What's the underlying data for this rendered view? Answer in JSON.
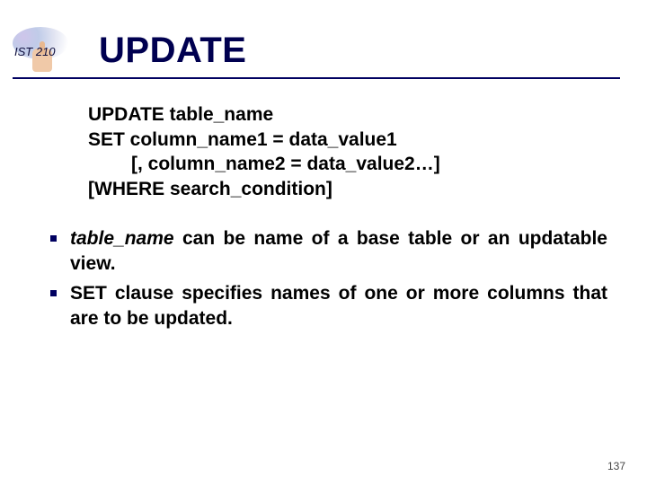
{
  "header": {
    "course_label": "IST 210",
    "title": "UPDATE"
  },
  "syntax": {
    "line1": "UPDATE table_name",
    "line2": "SET column_name1 = data_value1",
    "line3": "[, column_name2 = data_value2…]",
    "line4": "[WHERE search_condition]"
  },
  "bullets": {
    "b1_em": "table_name",
    "b1_rest": " can be name of a base table or an updatable view.",
    "b2": "SET clause specifies names of one or more columns that are to be updated."
  },
  "page_number": "137"
}
